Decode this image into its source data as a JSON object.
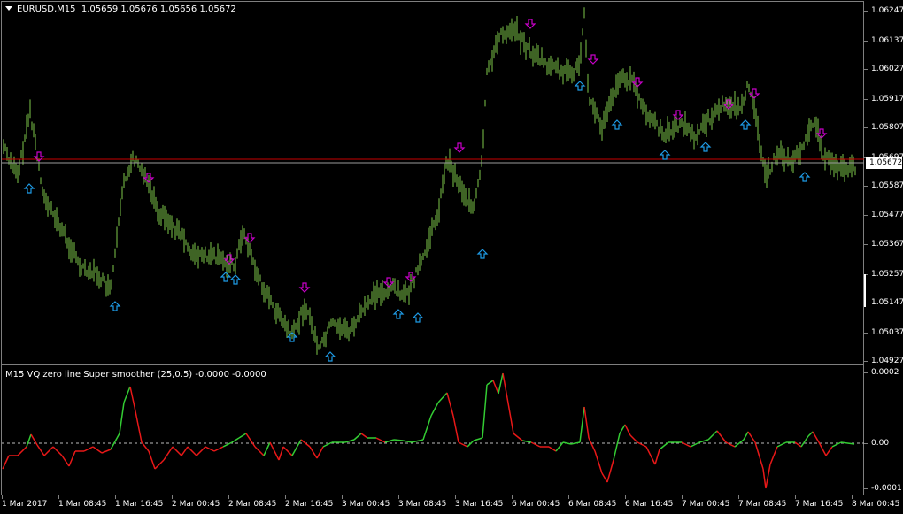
{
  "chart": {
    "symbol": "EURUSD,M15",
    "ohlc": "1.05659 1.05676 1.05656 1.05672",
    "current_price": "1.05672",
    "indicator_title": "M15 VQ zero line Super smoother (25,0.5) -0.0000 -0.0000"
  },
  "price_axis": [
    "1.06247",
    "1.06137",
    "1.06027",
    "1.05917",
    "1.05807",
    "1.05697",
    "1.05587",
    "1.05477",
    "1.05367",
    "1.05257",
    "1.05147",
    "1.05037",
    "1.04927"
  ],
  "ind_axis": [
    "0.0002",
    "0.00",
    "-0.0001"
  ],
  "time_axis": [
    "1 Mar 2017",
    "1 Mar 08:45",
    "1 Mar 16:45",
    "2 Mar 00:45",
    "2 Mar 08:45",
    "2 Mar 16:45",
    "3 Mar 00:45",
    "3 Mar 08:45",
    "3 Mar 16:45",
    "6 Mar 00:45",
    "6 Mar 08:45",
    "6 Mar 16:45",
    "7 Mar 00:45",
    "7 Mar 08:45",
    "7 Mar 16:45",
    "8 Mar 00:45"
  ],
  "colors": {
    "bars": "#7ec84a",
    "up_arrow": "#1e9be6",
    "down_arrow": "#c800c8",
    "ind_up": "#33cc33",
    "ind_down": "#e81818",
    "price_line": "#c80000"
  },
  "chart_data": {
    "type": "line",
    "series": [
      {
        "name": "EURUSD,M15",
        "x": [
          "1 Mar 2017",
          "1 Mar 08:45",
          "1 Mar 16:45",
          "2 Mar 00:45",
          "2 Mar 08:45",
          "2 Mar 16:45",
          "3 Mar 00:45",
          "3 Mar 08:45",
          "3 Mar 16:45",
          "6 Mar 00:45",
          "6 Mar 08:45",
          "6 Mar 16:45",
          "7 Mar 00:45",
          "7 Mar 08:45",
          "7 Mar 16:45",
          "8 Mar 00:45"
        ],
        "values": [
          1.0571,
          1.056,
          1.056,
          1.0536,
          1.053,
          1.051,
          1.05,
          1.0523,
          1.0555,
          1.0615,
          1.0605,
          1.059,
          1.0585,
          1.0585,
          1.057,
          1.0567
        ]
      },
      {
        "name": "M15 VQ zero line Super smoother (25,0.5)",
        "x": [
          "1 Mar 2017",
          "1 Mar 08:45",
          "1 Mar 16:45",
          "2 Mar 00:45",
          "2 Mar 08:45",
          "2 Mar 16:45",
          "3 Mar 00:45",
          "3 Mar 08:45",
          "3 Mar 16:45",
          "6 Mar 00:45",
          "6 Mar 08:45",
          "6 Mar 16:45",
          "7 Mar 00:45",
          "7 Mar 08:45",
          "7 Mar 16:45",
          "8 Mar 00:45"
        ],
        "values": [
          0.0,
          -1e-05,
          0.00014,
          -1e-05,
          1e-05,
          0.0,
          1e-05,
          1e-05,
          0.00013,
          -1e-05,
          5e-05,
          2e-05,
          -1e-05,
          1e-05,
          -1e-05,
          0.0
        ]
      }
    ],
    "ylim": [
      1.04927,
      1.06247
    ]
  }
}
